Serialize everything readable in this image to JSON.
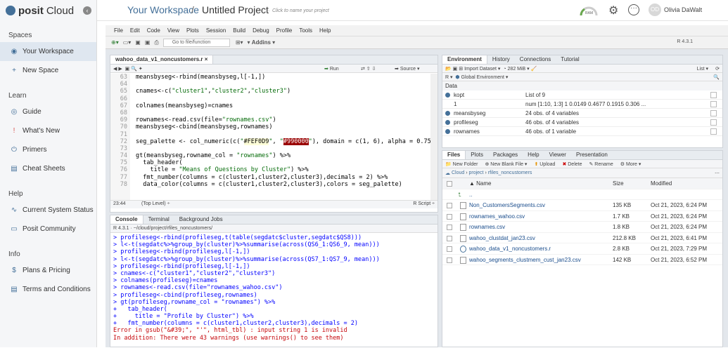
{
  "nav": {
    "brand": "posit",
    "brand_suffix": "Cloud",
    "sections": [
      {
        "title": "Spaces",
        "items": [
          {
            "label": "Your Workspace",
            "icon": "workspace-icon"
          },
          {
            "label": "New Space",
            "icon": "plus-icon"
          }
        ]
      },
      {
        "title": "Learn",
        "items": [
          {
            "label": "Guide",
            "icon": "compass-icon"
          },
          {
            "label": "What's New",
            "icon": "exclamation-icon"
          },
          {
            "label": "Primers",
            "icon": "power-icon"
          },
          {
            "label": "Cheat Sheets",
            "icon": "book-icon"
          }
        ]
      },
      {
        "title": "Help",
        "items": [
          {
            "label": "Current System Status",
            "icon": "pulse-icon"
          },
          {
            "label": "Posit Community",
            "icon": "chat-icon"
          }
        ]
      },
      {
        "title": "Info",
        "items": [
          {
            "label": "Plans & Pricing",
            "icon": "dollar-icon"
          },
          {
            "label": "Terms and Conditions",
            "icon": "document-icon"
          }
        ]
      }
    ]
  },
  "header": {
    "workspace": "Your Workspace",
    "separator": "/",
    "project": "Untitled Project",
    "hint": "← Click to name your project",
    "ram": "RAM",
    "avatar_initials": "OD",
    "user": "Olivia DaWalt"
  },
  "menubar": [
    "File",
    "Edit",
    "Code",
    "View",
    "Plots",
    "Session",
    "Build",
    "Debug",
    "Profile",
    "Tools",
    "Help"
  ],
  "toolbar": {
    "goto": "Go to file/function",
    "addins": "Addins",
    "r_version": "R 4.3.1"
  },
  "editor": {
    "tab": "wahoo_data_v1_noncustomers.r",
    "run": "Run",
    "source": "Source",
    "line_numbers": [
      "63",
      "64",
      "65",
      "66",
      "67",
      "68",
      "69",
      "70",
      "71",
      "72",
      "73",
      "74",
      "75",
      "76",
      "77",
      "78"
    ],
    "lines": [
      "meansbyseg<-rbind(meansbyseg,l[-1,])",
      "",
      "cnames<-c(\"cluster1\",\"cluster2\",\"cluster3\")",
      "",
      "colnames(meansbyseg)=cnames",
      "",
      "rownames<-read.csv(file=\"rownames.csv\")",
      "meansbyseg<-cbind(meansbyseg,rownames)",
      "",
      "seg_palette <- col_numeric(c(\"#FEF0D9\", \"#990000\"), domain = c(1, 6), alpha = 0.75)",
      "",
      "gt(meansbyseg,rowname_col = \"rownames\") %>%",
      "  tab_header(",
      "    title = \"Means of Questions by Cluster\") %>%",
      "  fmt_number(columns = c(cluster1,cluster2,cluster3),decimals = 2) %>%",
      "  data_color(columns = c(cluster1,cluster2,cluster3),colors = seg_palette)"
    ],
    "status_pos": "23:44",
    "status_scope": "(Top Level) ÷",
    "status_type": "R Script ÷"
  },
  "console": {
    "tabs": [
      "Console",
      "Terminal",
      "Background Jobs"
    ],
    "path": "R 4.3.1 · ~/cloud/project/rfiles_noncustomers/",
    "lines": [
      {
        "t": "in",
        "s": "> profileseg<-rbind(profileseg,t(table(segdatc$cluster,segdatc$QS8)))"
      },
      {
        "t": "in",
        "s": "> l<-t(segdatc%>%group_by(cluster)%>%summarise(across(QS6_1:QS6_9, mean)))"
      },
      {
        "t": "in",
        "s": "> profileseg<-rbind(profileseg,l[-1,])"
      },
      {
        "t": "in",
        "s": "> l<-t(segdatc%>%group_by(cluster)%>%summarise(across(QS7_1:QS7_9, mean)))"
      },
      {
        "t": "in",
        "s": "> profileseg<-rbind(profileseg,l[-1,])"
      },
      {
        "t": "in",
        "s": "> cnames<-c(\"cluster1\",\"cluster2\",\"cluster3\")"
      },
      {
        "t": "in",
        "s": "> colnames(profileseg)=cnames"
      },
      {
        "t": "in",
        "s": "> rownames<-read.csv(file=\"rownames_wahoo.csv\")"
      },
      {
        "t": "in",
        "s": "> profileseg<-cbind(profileseg,rownames)"
      },
      {
        "t": "in",
        "s": "> gt(profileseg,rowname_col = \"rownames\") %>%"
      },
      {
        "t": "in",
        "s": "+   tab_header("
      },
      {
        "t": "in",
        "s": "+     title = \"Profile by Cluster\") %>%"
      },
      {
        "t": "in",
        "s": "+   fmt_number(columns = c(cluster1,cluster2,cluster3),decimals = 2)"
      },
      {
        "t": "err",
        "s": "Error in gsub(\"&#39;\", \"'\", html_tbl) : input string 1 is invalid"
      },
      {
        "t": "err",
        "s": "In addition: There were 43 warnings (use warnings() to see them)"
      }
    ]
  },
  "env": {
    "tabs": [
      "Environment",
      "History",
      "Connections",
      "Tutorial"
    ],
    "import": "Import Dataset",
    "mem": "282 MiB",
    "list": "List",
    "r": "R",
    "global": "Global Environment",
    "section": "Data",
    "rows": [
      {
        "name": "kopt",
        "value": "List of  9",
        "dot": true
      },
      {
        "name": "1",
        "value": "num [1:10, 1:3] 1 0.0149 0.4677 0.1915 0.306 ...",
        "dot": false
      },
      {
        "name": "meansbyseg",
        "value": "24 obs. of 4 variables",
        "dot": true
      },
      {
        "name": "profileseg",
        "value": "46 obs. of 4 variables",
        "dot": true
      },
      {
        "name": "rownames",
        "value": "46 obs. of 1 variable",
        "dot": true
      }
    ]
  },
  "files": {
    "tabs": [
      "Files",
      "Plots",
      "Packages",
      "Help",
      "Viewer",
      "Presentation"
    ],
    "actions": [
      "New Folder",
      "New Blank File",
      "Upload",
      "Delete",
      "Rename",
      "More"
    ],
    "breadcrumb": [
      "Cloud",
      "project",
      "rfiles_noncustomers"
    ],
    "cols": [
      "Name",
      "Size",
      "Modified"
    ],
    "up": "..",
    "rows": [
      {
        "name": "Non_CustomersSegments.csv",
        "size": "135 KB",
        "mod": "Oct 21, 2023, 6:24 PM"
      },
      {
        "name": "rownames_wahoo.csv",
        "size": "1.7 KB",
        "mod": "Oct 21, 2023, 6:24 PM"
      },
      {
        "name": "rownames.csv",
        "size": "1.8 KB",
        "mod": "Oct 21, 2023, 6:24 PM"
      },
      {
        "name": "wahoo_clustdat_jan23.csv",
        "size": "212.8 KB",
        "mod": "Oct 21, 2023, 6:41 PM"
      },
      {
        "name": "wahoo_data_v1_noncustomers.r",
        "size": "2.8 KB",
        "mod": "Oct 21, 2023, 7:29 PM"
      },
      {
        "name": "wahoo_segments_clustmem_cust_jan23.csv",
        "size": "142 KB",
        "mod": "Oct 21, 2023, 6:52 PM"
      }
    ]
  }
}
